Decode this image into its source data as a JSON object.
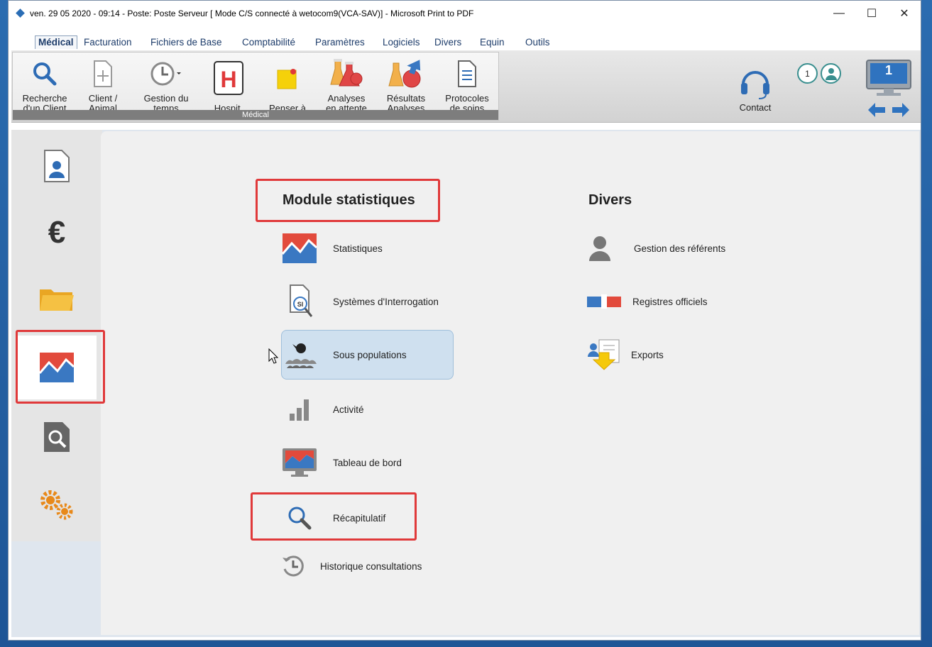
{
  "window": {
    "title": "ven. 29 05 2020 - 09:14 - Poste: Poste Serveur  [ Mode C/S connecté à wetocom9(VCA-SAV)] - Microsoft Print to PDF",
    "minimize": "—",
    "maximize": "☐",
    "close": "✕"
  },
  "menu": {
    "tabs": [
      {
        "label": "Médical",
        "active": true
      },
      {
        "label": "Facturation"
      },
      {
        "label": "Fichiers de Base"
      },
      {
        "label": "Comptabilité"
      },
      {
        "label": "Paramètres"
      },
      {
        "label": "Logiciels"
      },
      {
        "label": "Divers"
      },
      {
        "label": "Equin"
      },
      {
        "label": "Outils"
      }
    ]
  },
  "ribbon": {
    "group_label": "Médical",
    "buttons": [
      {
        "label1": "Recherche",
        "label2": "d'un Client",
        "icon": "search-icon"
      },
      {
        "label1": "Client /",
        "label2": "Animal",
        "icon": "new-document-icon"
      },
      {
        "label1": "Gestion du",
        "label2": "temps",
        "icon": "clock-icon"
      },
      {
        "label1": "",
        "label2": "Hospit.",
        "icon": "hospital-icon"
      },
      {
        "label1": "",
        "label2": "Penser à",
        "icon": "sticky-note-icon"
      },
      {
        "label1": "Analyses",
        "label2": "en attente",
        "icon": "lab-flasks-icon"
      },
      {
        "label1": "Résultats",
        "label2": "Analyses",
        "icon": "lab-results-icon"
      },
      {
        "label1": "Protocoles",
        "label2": "de soins",
        "icon": "protocol-document-icon"
      }
    ],
    "contact_label": "Contact",
    "badge_count": "1",
    "screen_number": "1"
  },
  "sections": {
    "stats_title": "Module statistiques",
    "divers_title": "Divers"
  },
  "stats_items": [
    {
      "label": "Statistiques",
      "icon": "chart-icon"
    },
    {
      "label": "Systèmes d'Interrogation",
      "icon": "query-document-icon"
    },
    {
      "label": "Sous populations",
      "icon": "animals-population-icon"
    },
    {
      "label": "Activité",
      "icon": "bar-chart-icon"
    },
    {
      "label": "Tableau de bord",
      "icon": "dashboard-monitor-icon"
    },
    {
      "label": "Récapitulatif",
      "icon": "magnifier-icon"
    },
    {
      "label": "Historique consultations",
      "icon": "history-icon"
    }
  ],
  "divers_items": [
    {
      "label": "Gestion des référents",
      "icon": "user-silhouette-icon"
    },
    {
      "label": "Registres officiels",
      "icon": "official-register-icon"
    },
    {
      "label": "Exports",
      "icon": "export-icon"
    }
  ],
  "colors": {
    "accent": "#1e3d6b",
    "highlight": "#e0393a",
    "hover": "#cfe0ef"
  }
}
